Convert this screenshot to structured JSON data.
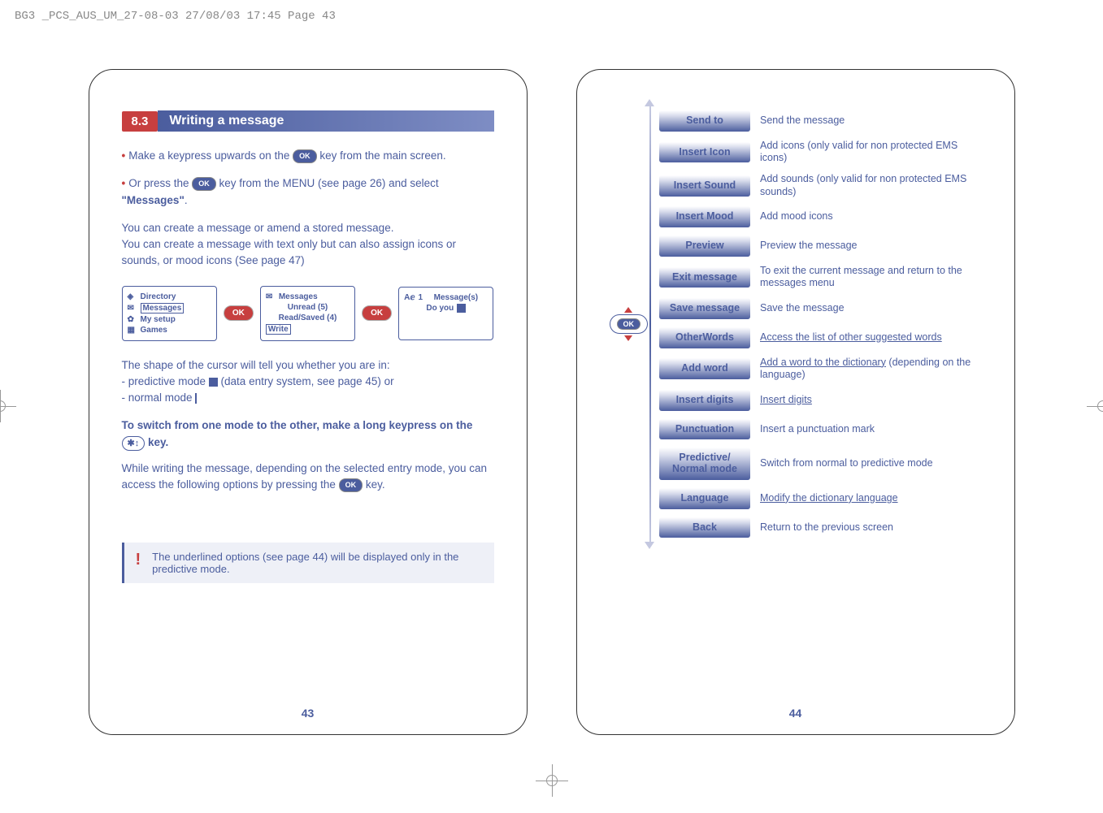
{
  "header": "BG3 _PCS_AUS_UM_27-08-03  27/08/03  17:45  Page 43",
  "left": {
    "section_num": "8.3",
    "section_title": "Writing a message",
    "line1_a": "Make a keypress upwards on the ",
    "line1_b": " key from the main screen.",
    "line2_a": "Or press the ",
    "line2_b": " key from the MENU (see page 26) and select ",
    "line2_bold": "\"Messages\"",
    "line2_end": ".",
    "para1": "You can create a message or amend a stored message.",
    "para2": "You can create a message with text only but can also assign icons or sounds, or mood icons (See page 47)",
    "ok_label": "OK",
    "screen1": {
      "items": [
        "Directory",
        "Messages",
        "My setup",
        "Games"
      ]
    },
    "screen2": {
      "title": "Messages",
      "items": [
        "Unread (5)",
        "Read/Saved (4)",
        "Write"
      ]
    },
    "screen3": {
      "count": "1",
      "title": "Message(s)",
      "text": "Do you"
    },
    "cursor_intro": "The shape of the cursor will tell you whether you are in:",
    "cursor_pred": "- predictive mode ",
    "cursor_pred_end": " (data entry system, see page 45) or",
    "cursor_norm": "- normal mode ",
    "switch_bold_a": "To switch from one mode to the other, make a long keypress on the ",
    "switch_bold_b": " key.",
    "while_text_a": "While writing the message, depending on the selected entry mode, you can access the following options by pressing the ",
    "while_text_b": " key.",
    "note": "The underlined options (see page 44) will be displayed only in the predictive mode.",
    "page_num": "43"
  },
  "right": {
    "ok_label": "OK",
    "menu": [
      {
        "label": "Send to",
        "desc": "Send the message",
        "ul": false
      },
      {
        "label": "Insert Icon",
        "desc": "Add icons (only valid for non protected EMS icons)",
        "ul": false
      },
      {
        "label": "Insert Sound",
        "desc": "Add sounds  (only valid for non protected EMS sounds)",
        "ul": false
      },
      {
        "label": "Insert Mood",
        "desc": "Add mood icons",
        "ul": false
      },
      {
        "label": "Preview",
        "desc": "Preview the message",
        "ul": false
      },
      {
        "label": "Exit message",
        "desc": "To exit the current message and return to the messages menu",
        "ul": false
      },
      {
        "label": "Save message",
        "desc": "Save the message",
        "ul": false
      },
      {
        "label": "OtherWords",
        "desc": "Access the list of other suggested words",
        "ul": true
      },
      {
        "label": "Add word",
        "desc_ul": "Add a word to the dictionary",
        "desc_rest": " (depending on the language)"
      },
      {
        "label": "Insert digits",
        "desc": "Insert digits",
        "ul": true
      },
      {
        "label": "Punctuation",
        "desc": "Insert a punctuation mark",
        "ul": false
      },
      {
        "label": "Predictive/\nNormal mode",
        "desc": "Switch from normal to predictive mode",
        "ul": false
      },
      {
        "label": "Language",
        "desc": "Modify the dictionary language",
        "ul": true
      },
      {
        "label": "Back",
        "desc": "Return to the previous screen",
        "ul": false
      }
    ],
    "page_num": "44"
  }
}
